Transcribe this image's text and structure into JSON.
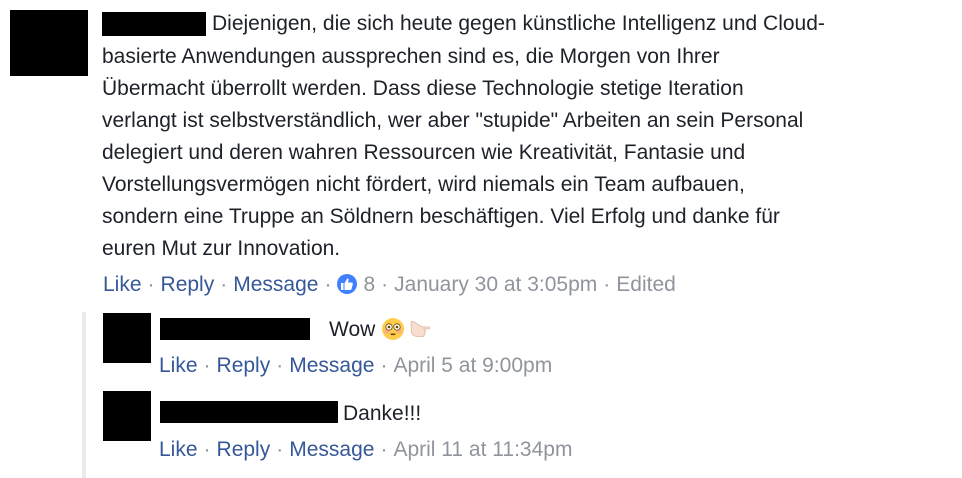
{
  "main_comment": {
    "lines": [
      "Diejenigen, die sich heute gegen künstliche Intelligenz und Cloud-",
      "basierte Anwendungen aussprechen sind es, die Morgen von Ihrer",
      "Übermacht überrollt werden. Dass diese Technologie stetige Iteration",
      "verlangt ist selbstverständlich, wer aber \"stupide\" Arbeiten an sein Personal",
      "delegiert und deren wahren Ressourcen wie Kreativität, Fantasie und",
      "Vorstellungsvermögen nicht fördert, wird niemals ein Team aufbauen,",
      "sondern eine Truppe an Söldnern beschäftigen. Viel Erfolg und danke für",
      "euren Mut zur Innovation."
    ],
    "actions": {
      "like": "Like",
      "reply": "Reply",
      "message": "Message",
      "reaction_count": "8",
      "timestamp": "January 30 at 3:05pm",
      "edited": "Edited"
    }
  },
  "replies": [
    {
      "text": "Wow",
      "actions": {
        "like": "Like",
        "reply": "Reply",
        "message": "Message",
        "timestamp": "April 5 at 9:00pm"
      }
    },
    {
      "text": "Danke!!!",
      "actions": {
        "like": "Like",
        "reply": "Reply",
        "message": "Message",
        "timestamp": "April 11 at 11:34pm"
      }
    }
  ],
  "colors": {
    "link": "#365899",
    "meta": "#90949c",
    "text": "#1d2129",
    "like_badge": "#4080ff"
  },
  "icons": [
    "like-reaction-icon",
    "flushed-face-emoji",
    "pointing-hand-emoji"
  ]
}
